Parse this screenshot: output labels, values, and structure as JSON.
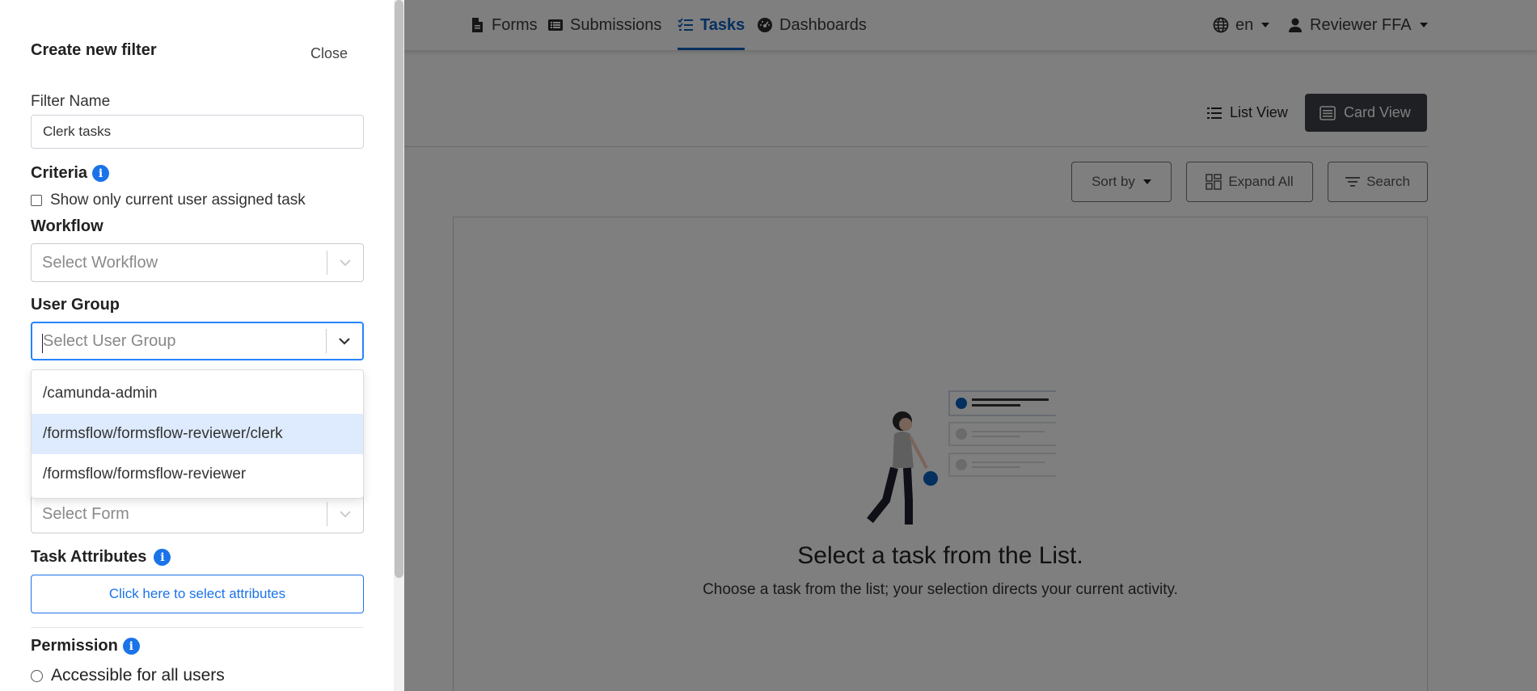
{
  "nav": {
    "items": [
      {
        "label": "Forms",
        "icon": "file-icon"
      },
      {
        "label": "Submissions",
        "icon": "list-icon"
      },
      {
        "label": "Tasks",
        "icon": "tasks-icon",
        "active": true
      },
      {
        "label": "Dashboards",
        "icon": "dashboard-icon"
      }
    ],
    "language": "en",
    "user": "Reviewer FFA"
  },
  "views": {
    "list_label": "List View",
    "card_label": "Card View",
    "active": "Card View"
  },
  "toolbar": {
    "sort_label": "Sort by",
    "expand_label": "Expand All",
    "search_label": "Search"
  },
  "empty_state": {
    "title": "Select a task from the List.",
    "subtitle": "Choose a task from the list; your selection directs your current activity."
  },
  "panel": {
    "title": "Create new filter",
    "close_label": "Close",
    "filter_name_label": "Filter Name",
    "filter_name_value": "Clerk tasks",
    "criteria_label": "Criteria",
    "assigned_checkbox_label": "Show only current user assigned task",
    "workflow_label": "Workflow",
    "workflow_placeholder": "Select Workflow",
    "user_group_label": "User Group",
    "user_group_placeholder": "Select User Group",
    "user_group_options": [
      "/camunda-admin",
      "/formsflow/formsflow-reviewer/clerk",
      "/formsflow/formsflow-reviewer"
    ],
    "user_group_highlighted": "/formsflow/formsflow-reviewer/clerk",
    "form_placeholder": "Select Form",
    "task_attributes_label": "Task Attributes",
    "attributes_button": "Click here to select attributes",
    "permission_label": "Permission",
    "permission_option": "Accessible for all users"
  },
  "colors": {
    "accent": "#1a73e8",
    "nav_active": "#0b5fbf",
    "card_view_bg": "#3c4147",
    "option_highlight": "#deebff",
    "focus_border": "#2684ff"
  }
}
